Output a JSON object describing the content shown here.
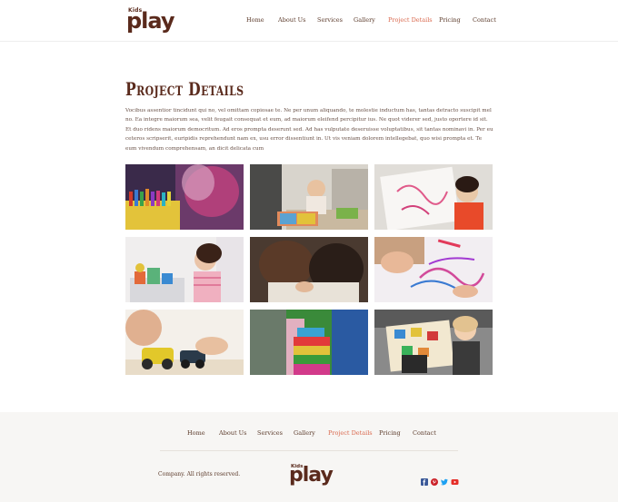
{
  "header": {
    "logo_small": "Kids",
    "logo_main": "play",
    "nav": [
      {
        "label": "Home"
      },
      {
        "label": "About Us"
      },
      {
        "label": "Services"
      },
      {
        "label": "Gallery"
      },
      {
        "label": "Project Details",
        "active": true
      },
      {
        "label": "Pricing"
      },
      {
        "label": "Contact"
      }
    ]
  },
  "main": {
    "title": "Project Details",
    "description": "Vocibus assentior tincidunt qui no, vel omittam copiosae te. Ne per unum aliquando, te molestie inductum has, tantas detracto suscipit mel no. Ea integre maiorum sea, velit feugait consequat et eum, ad maiorum eleifend percipitur ius. Ne quot viderer sed, justo oportere id sit. Et duo ridens maiorum democritum. Ad eros prompta deserunt sed. Ad has vulputate deseruisse voluptatibus, sit tantas nominavi in. Per eu ceteros scripserit, euripidis reprehendunt nam ex, usu error dissentiunt in. Ut vis veniam dolorem intellegebat, quo wisi prompta et. Te eum vivendum comprehensam, an dicit delicata cum",
    "gallery": [
      {
        "name": "crayons"
      },
      {
        "name": "child-reading-book"
      },
      {
        "name": "child-drawing-paper"
      },
      {
        "name": "girl-with-toys"
      },
      {
        "name": "kids-drawing-together"
      },
      {
        "name": "crayon-scribbles"
      },
      {
        "name": "toy-car"
      },
      {
        "name": "building-blocks"
      },
      {
        "name": "girl-with-tablet"
      }
    ]
  },
  "footer": {
    "nav": [
      {
        "label": "Home"
      },
      {
        "label": "About Us"
      },
      {
        "label": "Services"
      },
      {
        "label": "Gallery"
      },
      {
        "label": "Project Details",
        "active": true
      },
      {
        "label": "Pricing"
      },
      {
        "label": "Contact"
      }
    ],
    "copyright": "Company. All rights reserved.",
    "logo_small": "Kids",
    "logo_main": "play",
    "social": [
      {
        "icon": "facebook-icon",
        "color": "#3b5998"
      },
      {
        "icon": "pinterest-icon",
        "color": "#cb2027"
      },
      {
        "icon": "twitter-icon",
        "color": "#1da1f2"
      },
      {
        "icon": "youtube-icon",
        "color": "#e52d27"
      }
    ]
  },
  "colors": {
    "brand": "#5a2a1c",
    "accent": "#d9674c",
    "text": "#5b3a2a",
    "footer_bg": "#f7f6f4"
  }
}
